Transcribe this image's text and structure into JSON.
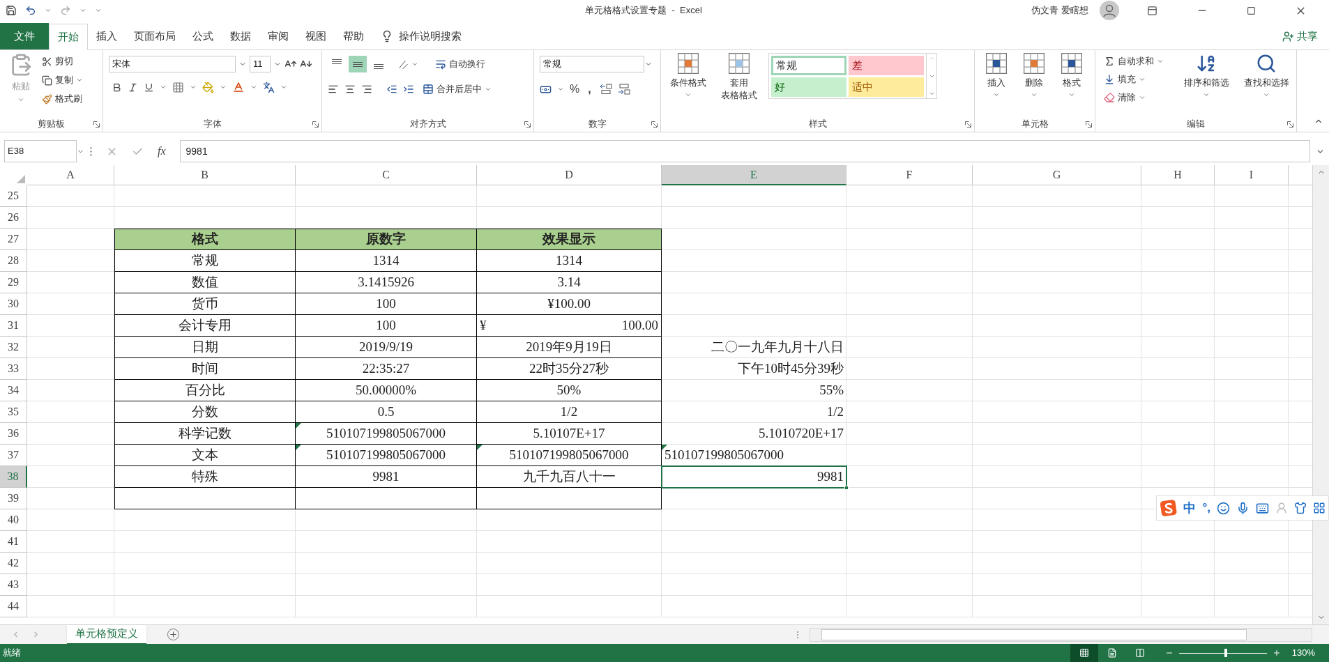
{
  "title_bar": {
    "title": "单元格格式设置专题  -  Excel",
    "user": "伪文青 爱瞎想"
  },
  "ribbon_tabs": [
    {
      "label": "文件",
      "kind": "file",
      "selected": false
    },
    {
      "label": "开始",
      "kind": "tab",
      "selected": true
    },
    {
      "label": "插入",
      "kind": "tab",
      "selected": false
    },
    {
      "label": "页面布局",
      "kind": "tab",
      "selected": false
    },
    {
      "label": "公式",
      "kind": "tab",
      "selected": false
    },
    {
      "label": "数据",
      "kind": "tab",
      "selected": false
    },
    {
      "label": "审阅",
      "kind": "tab",
      "selected": false
    },
    {
      "label": "视图",
      "kind": "tab",
      "selected": false
    },
    {
      "label": "帮助",
      "kind": "tab",
      "selected": false
    }
  ],
  "tell_me": "操作说明搜索",
  "share": "共享",
  "clipboard": {
    "label": "剪贴板",
    "paste": "粘贴",
    "cut": "剪切",
    "copy": "复制",
    "format_painter": "格式刷"
  },
  "font": {
    "label": "字体",
    "name": "宋体",
    "size": "11"
  },
  "alignment": {
    "label": "对齐方式",
    "vertical": [
      {
        "kind": "top",
        "selected": false
      },
      {
        "kind": "middle",
        "selected": true
      },
      {
        "kind": "bottom",
        "selected": false
      }
    ],
    "wrap": "自动换行",
    "merge": "合并后居中"
  },
  "number": {
    "label": "数字",
    "format": "常规",
    "percent": "%",
    "comma": ","
  },
  "styles": {
    "label": "样式",
    "conditional": "条件格式",
    "table_format": [
      "套用",
      "表格格式"
    ],
    "gallery": [
      {
        "label": "常规",
        "kind": "normal",
        "selected": true
      },
      {
        "label": "差",
        "kind": "bad",
        "selected": false
      },
      {
        "label": "好",
        "kind": "good",
        "selected": false
      },
      {
        "label": "适中",
        "kind": "neutral",
        "selected": false
      }
    ]
  },
  "cells": {
    "label": "单元格",
    "insert": "插入",
    "delete": "删除",
    "format": "格式"
  },
  "editing": {
    "label": "编辑",
    "autosum": "自动求和",
    "fill": "填充",
    "clear": "清除",
    "sort": "排序和筛选",
    "find": "查找和选择"
  },
  "formula_bar": {
    "name_box": "E38",
    "fx": "fx",
    "value": "9981"
  },
  "sheet": {
    "columns": [
      {
        "label": "A",
        "selected": false
      },
      {
        "label": "B",
        "selected": false
      },
      {
        "label": "C",
        "selected": false
      },
      {
        "label": "D",
        "selected": false
      },
      {
        "label": "E",
        "selected": true
      },
      {
        "label": "F",
        "selected": false
      },
      {
        "label": "G",
        "selected": false
      },
      {
        "label": "H",
        "selected": false
      },
      {
        "label": "I",
        "selected": false
      }
    ],
    "rows": [
      {
        "number": "25",
        "kind": "plain",
        "selected": false
      },
      {
        "number": "26",
        "kind": "plain",
        "selected": false
      },
      {
        "number": "27",
        "kind": "header",
        "selected": false,
        "cells": [
          {
            "text": "格式",
            "selected": false
          },
          {
            "text": "原数字",
            "selected": false
          },
          {
            "text": "效果显示",
            "selected": false
          },
          {
            "selected": false
          }
        ]
      },
      {
        "number": "28",
        "kind": "body",
        "selected": false,
        "cells": [
          {
            "text": "常规",
            "selected": false
          },
          {
            "text": "1314",
            "selected": false
          },
          {
            "text": "1314",
            "selected": false
          },
          {
            "selected": false
          }
        ]
      },
      {
        "number": "29",
        "kind": "body",
        "selected": false,
        "cells": [
          {
            "text": "数值",
            "selected": false
          },
          {
            "text": "3.1415926",
            "selected": false
          },
          {
            "text": "3.14",
            "selected": false
          },
          {
            "selected": false
          }
        ]
      },
      {
        "number": "30",
        "kind": "body",
        "selected": false,
        "cells": [
          {
            "text": "货币",
            "selected": false
          },
          {
            "text": "100",
            "selected": false
          },
          {
            "text": "¥100.00",
            "selected": false
          },
          {
            "selected": false
          }
        ]
      },
      {
        "number": "31",
        "kind": "body",
        "selected": false,
        "cells": [
          {
            "text": "会计专用",
            "selected": false
          },
          {
            "text": "100",
            "selected": false
          },
          {
            "kind": "accounting",
            "symbol": "¥",
            "text": "100.00",
            "selected": false
          },
          {
            "selected": false
          }
        ]
      },
      {
        "number": "32",
        "kind": "body",
        "selected": false,
        "cells": [
          {
            "text": "日期",
            "selected": false
          },
          {
            "text": "2019/9/19",
            "selected": false
          },
          {
            "text": "2019年9月19日",
            "selected": false
          },
          {
            "text": "二〇一九年九月十八日",
            "selected": false
          }
        ]
      },
      {
        "number": "33",
        "kind": "body",
        "selected": false,
        "cells": [
          {
            "text": "时间",
            "selected": false
          },
          {
            "text": "22:35:27",
            "selected": false
          },
          {
            "text": "22时35分27秒",
            "selected": false
          },
          {
            "text": "下午10时45分39秒",
            "selected": false
          }
        ]
      },
      {
        "number": "34",
        "kind": "body",
        "selected": false,
        "cells": [
          {
            "text": "百分比",
            "selected": false
          },
          {
            "text": "50.00000%",
            "selected": false
          },
          {
            "text": "50%",
            "selected": false
          },
          {
            "text": "55%",
            "selected": false
          }
        ]
      },
      {
        "number": "35",
        "kind": "body",
        "selected": false,
        "cells": [
          {
            "text": "分数",
            "selected": false
          },
          {
            "text": "0.5",
            "selected": false
          },
          {
            "text": "1/2",
            "selected": false
          },
          {
            "text": "1/2",
            "selected": false
          }
        ]
      },
      {
        "number": "36",
        "kind": "body",
        "selected": false,
        "cells": [
          {
            "text": "科学记数",
            "selected": false
          },
          {
            "text": "510107199805067000",
            "flag": true,
            "selected": false
          },
          {
            "text": "5.10107E+17",
            "selected": false
          },
          {
            "text": "5.1010720E+17",
            "selected": false
          }
        ]
      },
      {
        "number": "37",
        "kind": "body",
        "selected": false,
        "cells": [
          {
            "text": "文本",
            "selected": false
          },
          {
            "text": "510107199805067000",
            "flag": true,
            "selected": false
          },
          {
            "text": "510107199805067000",
            "flag": true,
            "selected": false
          },
          {
            "text": "510107199805067000",
            "flag": true,
            "kind": "text",
            "selected": false
          }
        ]
      },
      {
        "number": "38",
        "kind": "body",
        "selected": true,
        "cells": [
          {
            "text": "特殊",
            "selected": false
          },
          {
            "text": "9981",
            "selected": false
          },
          {
            "text": "九千九百八十一",
            "selected": false
          },
          {
            "text": "9981",
            "selected": true
          }
        ]
      },
      {
        "number": "39",
        "kind": "body",
        "selected": false,
        "cells": [
          {
            "selected": false
          },
          {
            "selected": false
          },
          {
            "selected": false
          },
          {
            "selected": false
          }
        ]
      },
      {
        "number": "40",
        "kind": "plain",
        "selected": false
      },
      {
        "number": "41",
        "kind": "plain",
        "selected": false
      },
      {
        "number": "42",
        "kind": "plain",
        "selected": false
      },
      {
        "number": "43",
        "kind": "plain",
        "selected": false
      },
      {
        "number": "44",
        "kind": "plain",
        "selected": false
      }
    ]
  },
  "sheet_tabs": [
    {
      "label": "单元格预定义",
      "selected": true
    }
  ],
  "status_bar": {
    "status": "就绪",
    "views": [
      {
        "kind": "normal",
        "selected": true
      },
      {
        "kind": "page_layout",
        "selected": false
      },
      {
        "kind": "page_break",
        "selected": false
      }
    ],
    "zoom_slider": {
      "level": 0.53
    },
    "zoom": "130%"
  },
  "ime_toolbar": {
    "mode": "中",
    "punctuation": "°,"
  }
}
